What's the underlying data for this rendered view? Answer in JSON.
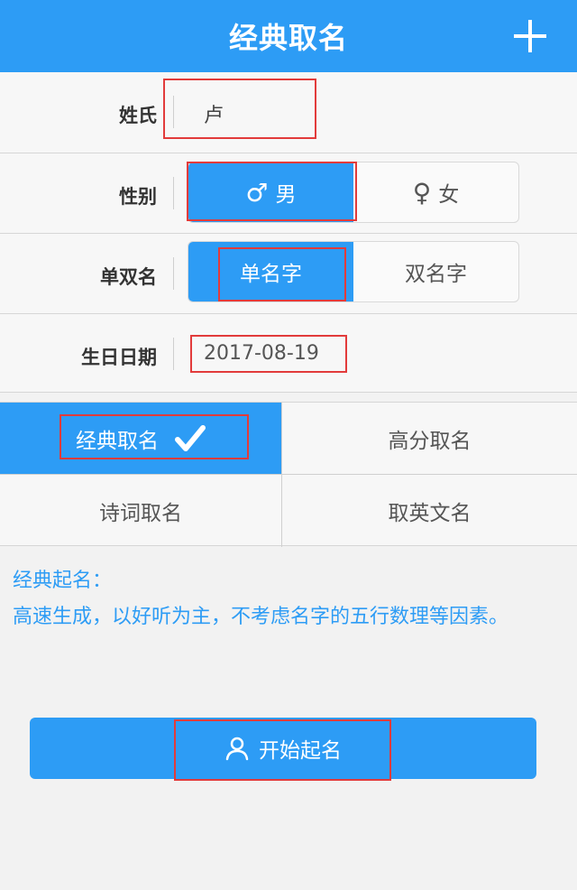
{
  "header": {
    "title": "经典取名",
    "add_icon": "plus-icon"
  },
  "form": {
    "surname": {
      "label": "姓氏",
      "value": "卢"
    },
    "gender": {
      "label": "性别",
      "options": [
        {
          "symbol": "♂",
          "label": "男",
          "selected": true
        },
        {
          "symbol": "♀",
          "label": "女",
          "selected": false
        }
      ]
    },
    "name_length": {
      "label": "单双名",
      "options": [
        {
          "label": "单名字",
          "selected": true
        },
        {
          "label": "双名字",
          "selected": false
        }
      ]
    },
    "birthday": {
      "label": "生日日期",
      "value": "2017-08-19"
    }
  },
  "modes": [
    {
      "label": "经典取名",
      "selected": true
    },
    {
      "label": "高分取名",
      "selected": false
    },
    {
      "label": "诗词取名",
      "selected": false
    },
    {
      "label": "取英文名",
      "selected": false
    }
  ],
  "description": {
    "title": "经典起名：",
    "body": "高速生成，以好听为主，不考虑名字的五行数理等因素。"
  },
  "start_button": {
    "label": "开始起名",
    "icon": "user-icon"
  },
  "colors": {
    "primary": "#2d9cf5",
    "highlight": "#e23b3b",
    "background": "#f2f2f2"
  }
}
